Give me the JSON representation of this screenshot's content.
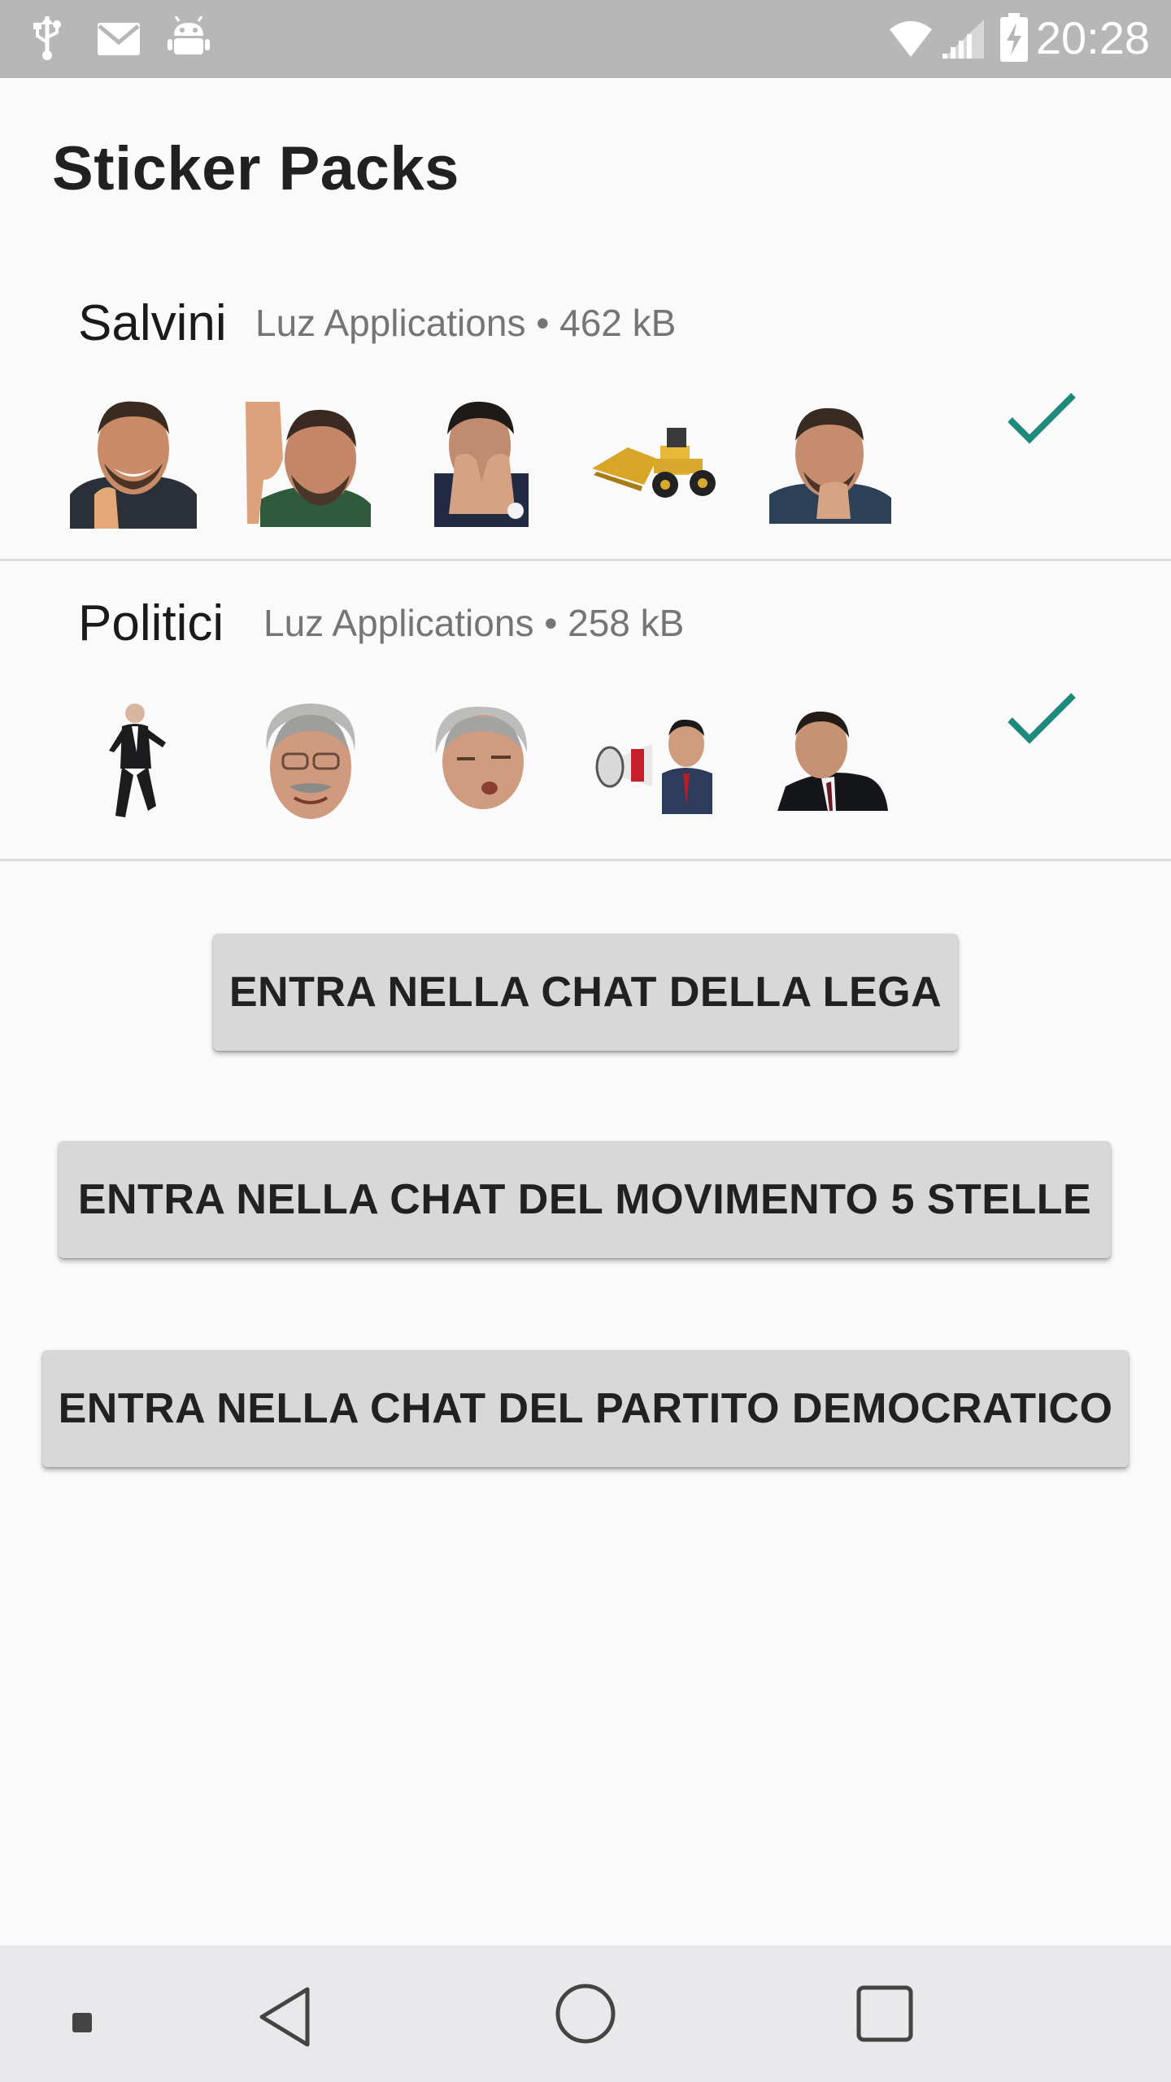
{
  "status_bar": {
    "time": "20:28",
    "left_icons": [
      "usb-icon",
      "gmail-icon",
      "android-debug-icon"
    ],
    "right_icons": [
      "wifi-icon",
      "signal-icon",
      "battery-charging-icon"
    ]
  },
  "page": {
    "title": "Sticker Packs"
  },
  "packs": [
    {
      "name": "Salvini",
      "meta": "Luz Applications • 462 kB",
      "added": true,
      "stickers": [
        "salvini-thumbs-up",
        "salvini-thumbs-down",
        "salvini-hands-face",
        "bulldozer",
        "salvini-thinking"
      ]
    },
    {
      "name": "Politici",
      "meta": "Luz Applications • 258 kB",
      "added": true,
      "stickers": [
        "man-dancing",
        "man-smiling-face",
        "man-kissing-face",
        "man-megaphone",
        "man-suit-portrait"
      ]
    }
  ],
  "buttons": {
    "lega": "ENTRA NELLA CHAT DELLA LEGA",
    "m5s": "ENTRA NELLA CHAT DEL MOVIMENTO 5 STELLE",
    "pd": "ENTRA NELLA CHAT DEL PARTITO DEMOCRATICO"
  },
  "colors": {
    "status_bar": "#b7b7b7",
    "background": "#fafafa",
    "check": "#1e8a7c",
    "button": "#d8d8d8",
    "nav_bar": "#e9e9ec"
  },
  "nav_bar": [
    "square-dot-icon",
    "back-icon",
    "home-icon",
    "recents-icon"
  ]
}
